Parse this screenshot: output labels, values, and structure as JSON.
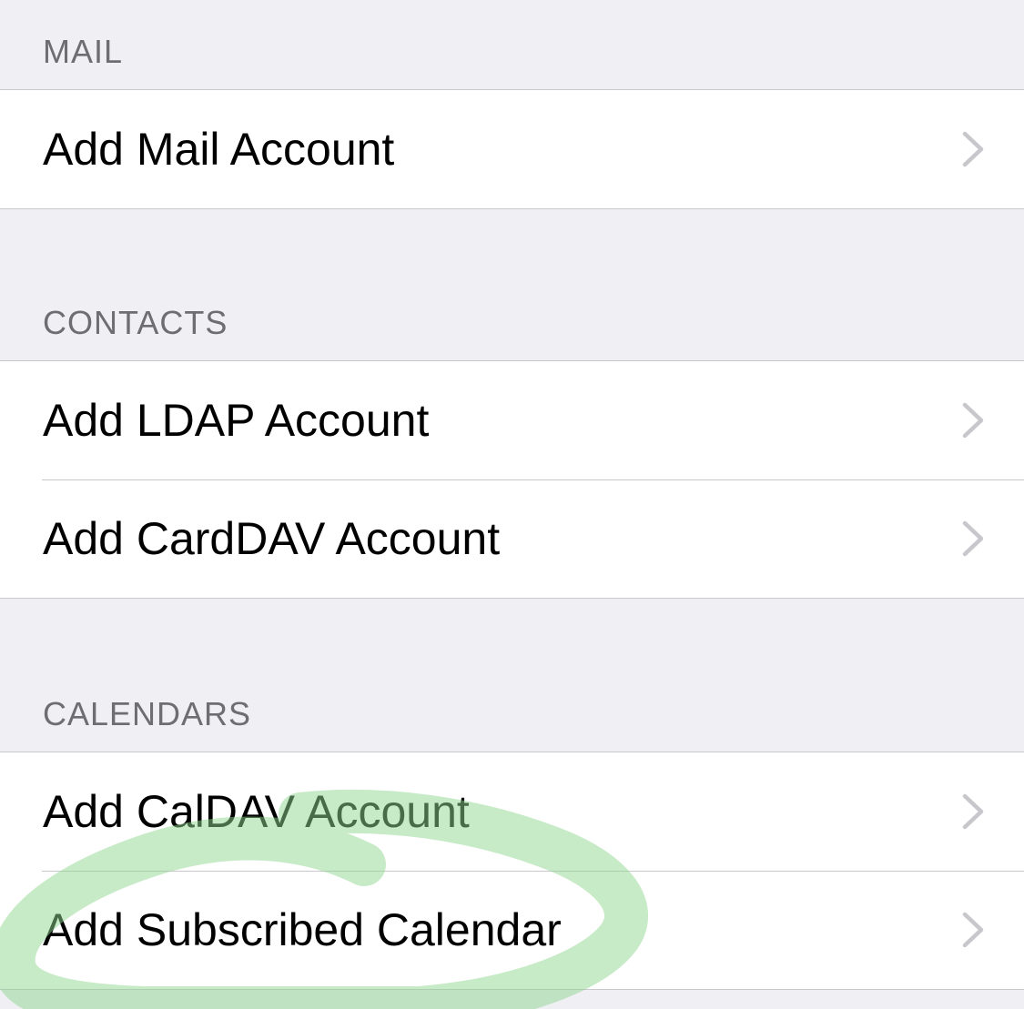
{
  "sections": [
    {
      "header": "MAIL",
      "rows": [
        {
          "label": "Add Mail Account"
        }
      ]
    },
    {
      "header": "CONTACTS",
      "rows": [
        {
          "label": "Add LDAP Account"
        },
        {
          "label": "Add CardDAV Account"
        }
      ]
    },
    {
      "header": "CALENDARS",
      "rows": [
        {
          "label": "Add CalDAV Account"
        },
        {
          "label": "Add Subscribed Calendar"
        }
      ]
    }
  ],
  "icons": {
    "row_disclosure": "chevron-right-icon"
  },
  "colors": {
    "background": "#efeff4",
    "section_header_text": "#6d6d72",
    "row_background": "#ffffff",
    "separator": "#c8c7cc",
    "chevron": "#c7c7cc",
    "highlight_annotation": "#8fd68f"
  }
}
